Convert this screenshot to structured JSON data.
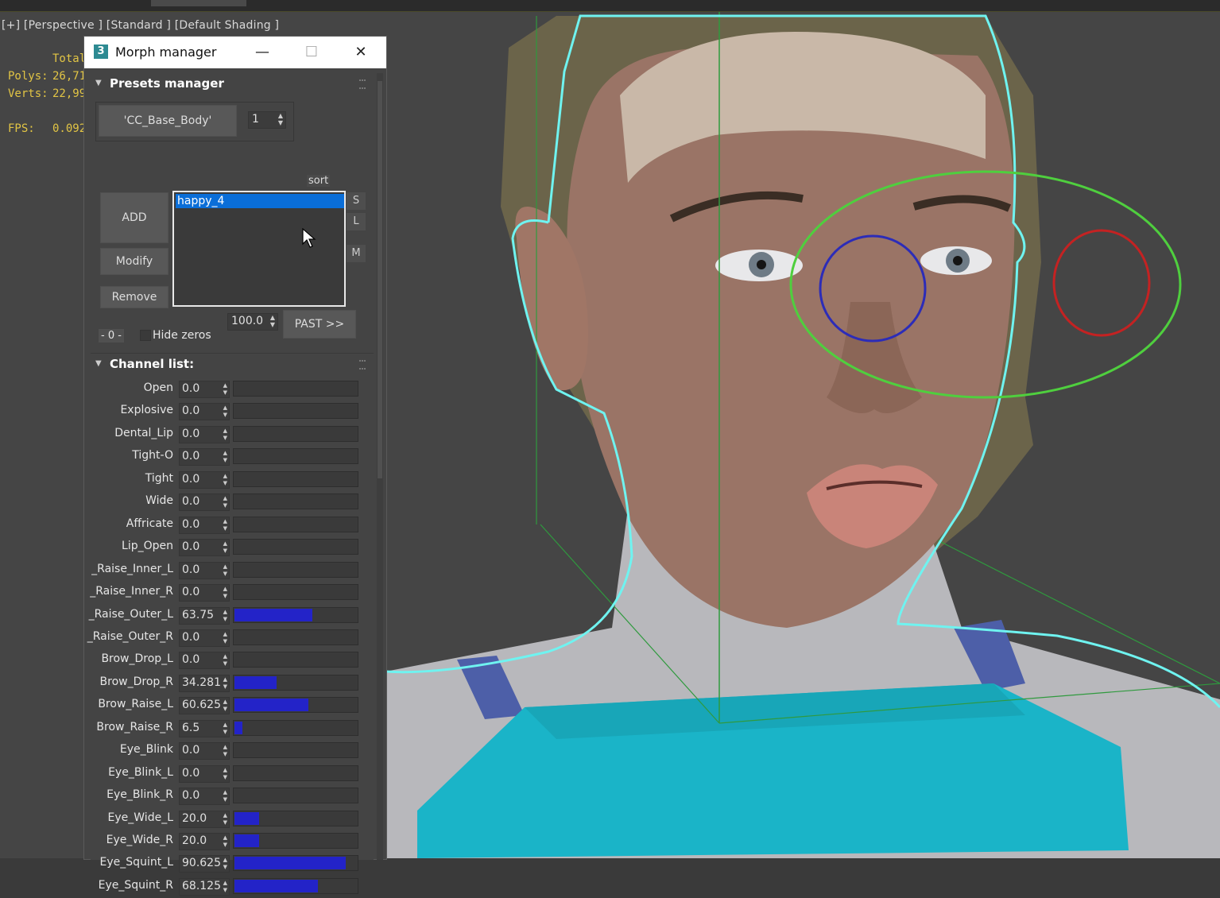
{
  "viewport": {
    "label": "[+] [Perspective ] [Standard ] [Default Shading ]",
    "stats": {
      "total_label": "Total",
      "polys_label": "Polys:",
      "polys_value": "26,71",
      "verts_label": "Verts:",
      "verts_value": "22,99",
      "fps_label": "FPS:",
      "fps_value": "0.092"
    }
  },
  "dialog": {
    "title": "Morph manager",
    "app_icon": "3",
    "minimize_icon": "—",
    "maximize_icon": "☐",
    "close_icon": "✕",
    "presets": {
      "rollout_title": "Presets manager",
      "target_button": "'CC_Base_Body'",
      "count_value": "1",
      "sort_label": "sort",
      "add_button": "ADD",
      "modify_button": "Modify",
      "remove_button": "Remove",
      "list_items": [
        "happy_4"
      ],
      "s_button": "S",
      "l_button": "L",
      "m_button": "M",
      "percent_value": "100.0",
      "past_button": "PAST >>",
      "zero_button": "- 0 -",
      "hide_zeros_label": "Hide zeros"
    },
    "channels": {
      "rollout_title": "Channel list:",
      "items": [
        {
          "name": "Open",
          "value": "0.0",
          "amount": 0
        },
        {
          "name": "Explosive",
          "value": "0.0",
          "amount": 0
        },
        {
          "name": "Dental_Lip",
          "value": "0.0",
          "amount": 0
        },
        {
          "name": "Tight-O",
          "value": "0.0",
          "amount": 0
        },
        {
          "name": "Tight",
          "value": "0.0",
          "amount": 0
        },
        {
          "name": "Wide",
          "value": "0.0",
          "amount": 0
        },
        {
          "name": "Affricate",
          "value": "0.0",
          "amount": 0
        },
        {
          "name": "Lip_Open",
          "value": "0.0",
          "amount": 0
        },
        {
          "name": "_Raise_Inner_L",
          "value": "0.0",
          "amount": 0
        },
        {
          "name": "_Raise_Inner_R",
          "value": "0.0",
          "amount": 0
        },
        {
          "name": "_Raise_Outer_L",
          "value": "63.75",
          "amount": 63.75
        },
        {
          "name": "_Raise_Outer_R",
          "value": "0.0",
          "amount": 0
        },
        {
          "name": "Brow_Drop_L",
          "value": "0.0",
          "amount": 0
        },
        {
          "name": "Brow_Drop_R",
          "value": "34.281",
          "amount": 34.281
        },
        {
          "name": "Brow_Raise_L",
          "value": "60.625",
          "amount": 60.625
        },
        {
          "name": "Brow_Raise_R",
          "value": "6.5",
          "amount": 6.5
        },
        {
          "name": "Eye_Blink",
          "value": "0.0",
          "amount": 0
        },
        {
          "name": "Eye_Blink_L",
          "value": "0.0",
          "amount": 0
        },
        {
          "name": "Eye_Blink_R",
          "value": "0.0",
          "amount": 0
        },
        {
          "name": "Eye_Wide_L",
          "value": "20.0",
          "amount": 20
        },
        {
          "name": "Eye_Wide_R",
          "value": "20.0",
          "amount": 20
        },
        {
          "name": "Eye_Squint_L",
          "value": "90.625",
          "amount": 90.625
        },
        {
          "name": "Eye_Squint_R",
          "value": "68.125",
          "amount": 68.125
        }
      ]
    }
  },
  "colors": {
    "bar_fill": "#2323c8",
    "selection": "#0a6ed8",
    "stats_text": "#e2c545",
    "outline_cyan": "#6ff3f0",
    "control_green": "#4fcf3e",
    "control_blue": "#2c2cb8",
    "control_red": "#c42222",
    "shirt_cyan": "#1ab4c8"
  }
}
